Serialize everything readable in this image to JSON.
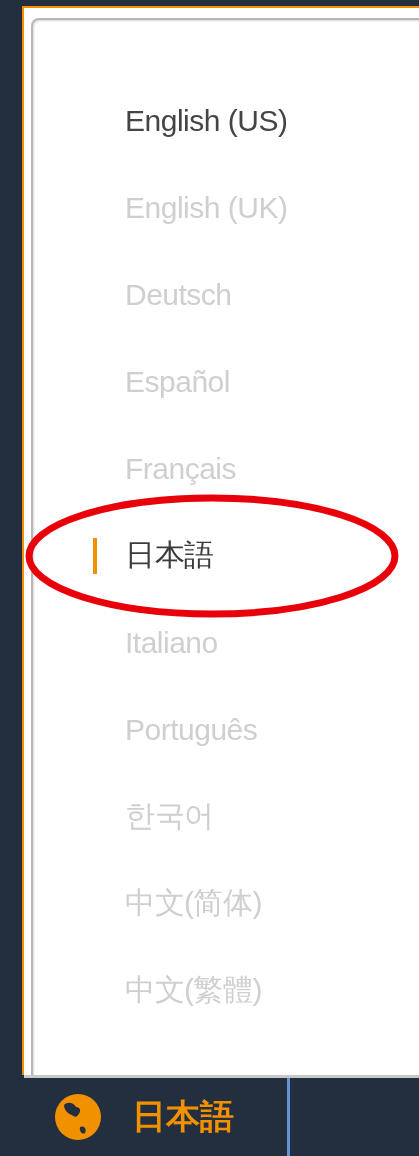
{
  "languages": [
    {
      "label": "English (US)",
      "selected": false,
      "hovered": true,
      "circled": false
    },
    {
      "label": "English (UK)",
      "selected": false,
      "hovered": false,
      "circled": false
    },
    {
      "label": "Deutsch",
      "selected": false,
      "hovered": false,
      "circled": false
    },
    {
      "label": "Español",
      "selected": false,
      "hovered": false,
      "circled": false
    },
    {
      "label": "Français",
      "selected": false,
      "hovered": false,
      "circled": false
    },
    {
      "label": "日本語",
      "selected": true,
      "hovered": false,
      "circled": true
    },
    {
      "label": "Italiano",
      "selected": false,
      "hovered": false,
      "circled": false
    },
    {
      "label": "Português",
      "selected": false,
      "hovered": false,
      "circled": false
    },
    {
      "label": "한국어",
      "selected": false,
      "hovered": false,
      "circled": false
    },
    {
      "label": "中文(简体)",
      "selected": false,
      "hovered": false,
      "circled": false
    },
    {
      "label": "中文(繁體)",
      "selected": false,
      "hovered": false,
      "circled": false
    }
  ],
  "footer": {
    "language": "日本語"
  }
}
